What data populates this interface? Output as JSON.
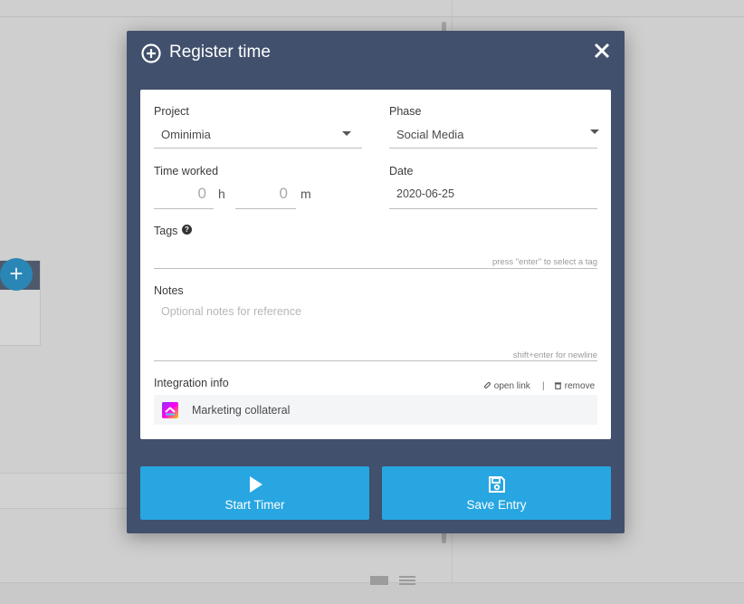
{
  "modal": {
    "title": "Register time",
    "project": {
      "label": "Project",
      "value": "Ominimia"
    },
    "phase": {
      "label": "Phase",
      "value": "Social Media"
    },
    "time_worked": {
      "label": "Time worked",
      "hours": "0",
      "hours_unit": "h",
      "minutes": "0",
      "minutes_unit": "m"
    },
    "date": {
      "label": "Date",
      "value": "2020-06-25"
    },
    "tags": {
      "label": "Tags",
      "hint": "press \"enter\" to select a tag"
    },
    "notes": {
      "label": "Notes",
      "placeholder": "Optional notes for reference",
      "hint": "shift+enter for newline"
    },
    "integration": {
      "label": "Integration info",
      "open_link": "open link",
      "separator": "|",
      "remove": "remove",
      "item": "Marketing collateral"
    },
    "buttons": {
      "start_timer": "Start Timer",
      "save_entry": "Save Entry"
    },
    "colors": {
      "header_bg": "#41506d",
      "button_bg": "#27a6e1"
    }
  },
  "background": {
    "fab_symbol": "+"
  }
}
